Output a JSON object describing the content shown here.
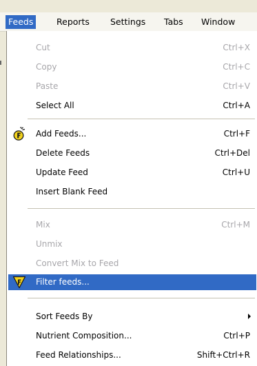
{
  "menubar": {
    "items": [
      {
        "label": "Feeds",
        "active": true
      },
      {
        "label": "Reports"
      },
      {
        "label": "Settings"
      },
      {
        "label": "Tabs"
      },
      {
        "label": "Window"
      }
    ]
  },
  "menu": {
    "items": [
      {
        "label": "Cut",
        "shortcut": "Ctrl+X",
        "disabled": true
      },
      {
        "label": "Copy",
        "shortcut": "Ctrl+C",
        "disabled": true
      },
      {
        "label": "Paste",
        "shortcut": "Ctrl+V",
        "disabled": true
      },
      {
        "label": "Select All",
        "shortcut": "Ctrl+A"
      },
      {
        "label": "Add Feeds...",
        "shortcut": "Ctrl+F",
        "icon": "add-feeds-icon"
      },
      {
        "label": "Delete Feeds",
        "shortcut": "Ctrl+Del"
      },
      {
        "label": "Update Feed",
        "shortcut": "Ctrl+U"
      },
      {
        "label": "Insert Blank Feed",
        "shortcut": ""
      },
      {
        "label": "Mix",
        "shortcut": "Ctrl+M",
        "disabled": true
      },
      {
        "label": "Unmix",
        "shortcut": "",
        "disabled": true
      },
      {
        "label": "Convert Mix to Feed",
        "shortcut": "",
        "disabled": true
      },
      {
        "label": "Filter feeds...",
        "shortcut": "",
        "icon": "filter-feeds-icon",
        "highlighted": true
      },
      {
        "label": "Sort Feeds By",
        "shortcut": "",
        "submenu": true
      },
      {
        "label": "Nutrient Composition...",
        "shortcut": "Ctrl+P"
      },
      {
        "label": "Feed Relationships...",
        "shortcut": "Shift+Ctrl+R"
      }
    ]
  },
  "colors": {
    "highlight": "#316ac5",
    "disabled_text": "#a7a6aa",
    "menubar_bg": "#f6f5ef"
  }
}
